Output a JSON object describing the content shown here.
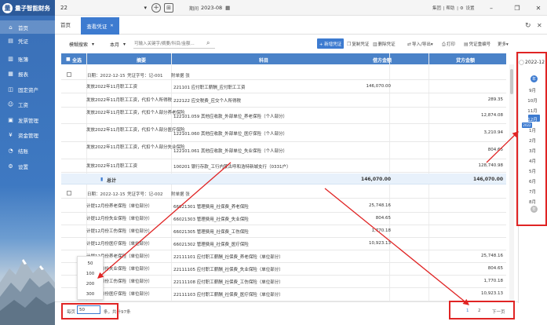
{
  "app": {
    "logo_text": "量子智能财务",
    "company": "22",
    "period_label": "期间",
    "period_value": "2023-08",
    "top_links": [
      "集团",
      "帮助",
      "设置"
    ]
  },
  "sidebar": {
    "items": [
      {
        "label": "首页",
        "icon": "home-icon"
      },
      {
        "label": "凭证",
        "icon": "voucher-icon"
      },
      {
        "label": "账簿",
        "icon": "ledger-icon"
      },
      {
        "label": "报表",
        "icon": "report-icon"
      },
      {
        "label": "固定资产",
        "icon": "asset-icon"
      },
      {
        "label": "工资",
        "icon": "salary-icon"
      },
      {
        "label": "发票管理",
        "icon": "invoice-icon"
      },
      {
        "label": "资金管理",
        "icon": "fund-icon"
      },
      {
        "label": "结账",
        "icon": "close-account-icon"
      },
      {
        "label": "设置",
        "icon": "settings-icon"
      }
    ]
  },
  "tabs": {
    "home": "首页",
    "active": "查看凭证"
  },
  "toolbar": {
    "search_mode": "模糊搜索",
    "period_mode": "本月",
    "search_placeholder": "可输入关键字/摘要/科目/金额...",
    "add_label": "+ 新增凭证",
    "actions": [
      "复制凭证",
      "删除凭证",
      "导入/导出",
      "打印",
      "凭证重编号",
      "更多"
    ]
  },
  "table": {
    "headers": [
      "全选",
      "摘要",
      "科目",
      "借方金额",
      "贷方金额"
    ],
    "voucher1": {
      "date_label": "日期：",
      "date": "2022-12-15",
      "no_label": "凭证字号：",
      "no": "记-001",
      "attach_label": "附单据",
      "attach": "张",
      "rows": [
        {
          "summary": "发放2022年11月职工工资",
          "account": "221101 应付职工薪酬_应付职工工资",
          "debit": "146,070.00",
          "credit": ""
        },
        {
          "summary": "发放2022年11月职工工资，代扣个人所得税",
          "account": "222122 应交税费_应交个人所得税",
          "debit": "",
          "credit": "289.35"
        },
        {
          "summary": "发放2022年11月职工工资，代扣个人部分养老保险",
          "account": "122101.059 其他应收款_外部单位_养老保险（个人部分）",
          "debit": "",
          "credit": "12,874.08"
        },
        {
          "summary": "发放2022年11月职工工资，代扣个人部分医疗保险",
          "account": "122101.060 其他应收款_外部单位_医疗保险（个人部分）",
          "debit": "",
          "credit": "3,210.94"
        },
        {
          "summary": "发放2022年11月职工工资，代扣个人部分失业保险",
          "account": "122101.061 其他应收款_外部单位_失业保险（个人部分）",
          "debit": "",
          "credit": "804.65"
        },
        {
          "summary": "发放2022年11月职工工资",
          "account": "100201 银行存款_工行内蒙古呼和浩特新城支行（0331户）",
          "debit": "",
          "credit": "128,740.98"
        }
      ],
      "total_label": "总计",
      "total_debit": "146,070.00",
      "total_credit": "146,070.00"
    },
    "voucher2": {
      "date_label": "日期：",
      "date": "2022-12-15",
      "no_label": "凭证字号：",
      "no": "记-002",
      "attach_label": "附单据",
      "attach": "张",
      "rows": [
        {
          "summary": "计提12月份养老保险（单位部分）",
          "account": "66021301 管理费用_社保费_养老保险",
          "debit": "25,748.16",
          "credit": ""
        },
        {
          "summary": "计提12月份失业保险（单位部分）",
          "account": "66021303 管理费用_社保费_失业保险",
          "debit": "804.65",
          "credit": ""
        },
        {
          "summary": "计提12月份工伤保险（单位部分）",
          "account": "66021305 管理费用_社保费_工伤保险",
          "debit": "1,770.18",
          "credit": ""
        },
        {
          "summary": "计提12月份医疗保险（单位部分）",
          "account": "66021302 管理费用_社保费_医疗保险",
          "debit": "10,923.13",
          "credit": ""
        },
        {
          "summary": "计提12月份养老保险（单位部分）",
          "account": "22111101 应付职工薪酬_社保费_养老保险（单位部分）",
          "debit": "",
          "credit": "25,748.16"
        },
        {
          "summary": "计提12月份失业保险（单位部分）",
          "account": "22111105 应付职工薪酬_社保费_失业保险（单位部分）",
          "debit": "",
          "credit": "804.65"
        },
        {
          "summary": "计提12月份工伤保险（单位部分）",
          "account": "22111108 应付职工薪酬_社保费_工伤保险（单位部分）",
          "debit": "",
          "credit": "1,770.18"
        },
        {
          "summary": "计提12月份医疗保险（单位部分）",
          "account": "22111103 应付职工薪酬_社保费_医疗保险（单位部分）",
          "debit": "",
          "credit": "10,923.13"
        }
      ]
    }
  },
  "pagination": {
    "page_size_options": [
      "50",
      "100",
      "200",
      "300"
    ],
    "per_page_label": "每页",
    "page_size": "50",
    "total_text": "条，共计97条",
    "pages": [
      "1",
      "2"
    ],
    "next_label": "下一页"
  },
  "month_panel": {
    "year": "2022-12",
    "year_dot": "年",
    "months_top": [
      "9月",
      "10月",
      "11月"
    ],
    "selected_month": "12月",
    "selected_tag": "2022",
    "months_bottom": [
      "1月",
      "2月",
      "3月",
      "4月",
      "5月",
      "6月",
      "7月",
      "8月"
    ],
    "bottom_dot": "年"
  },
  "colors": {
    "primary": "#3d7bd0",
    "table_header": "#4a82c8",
    "sidebar": "#3a70b8",
    "annotation": "#e02424"
  }
}
